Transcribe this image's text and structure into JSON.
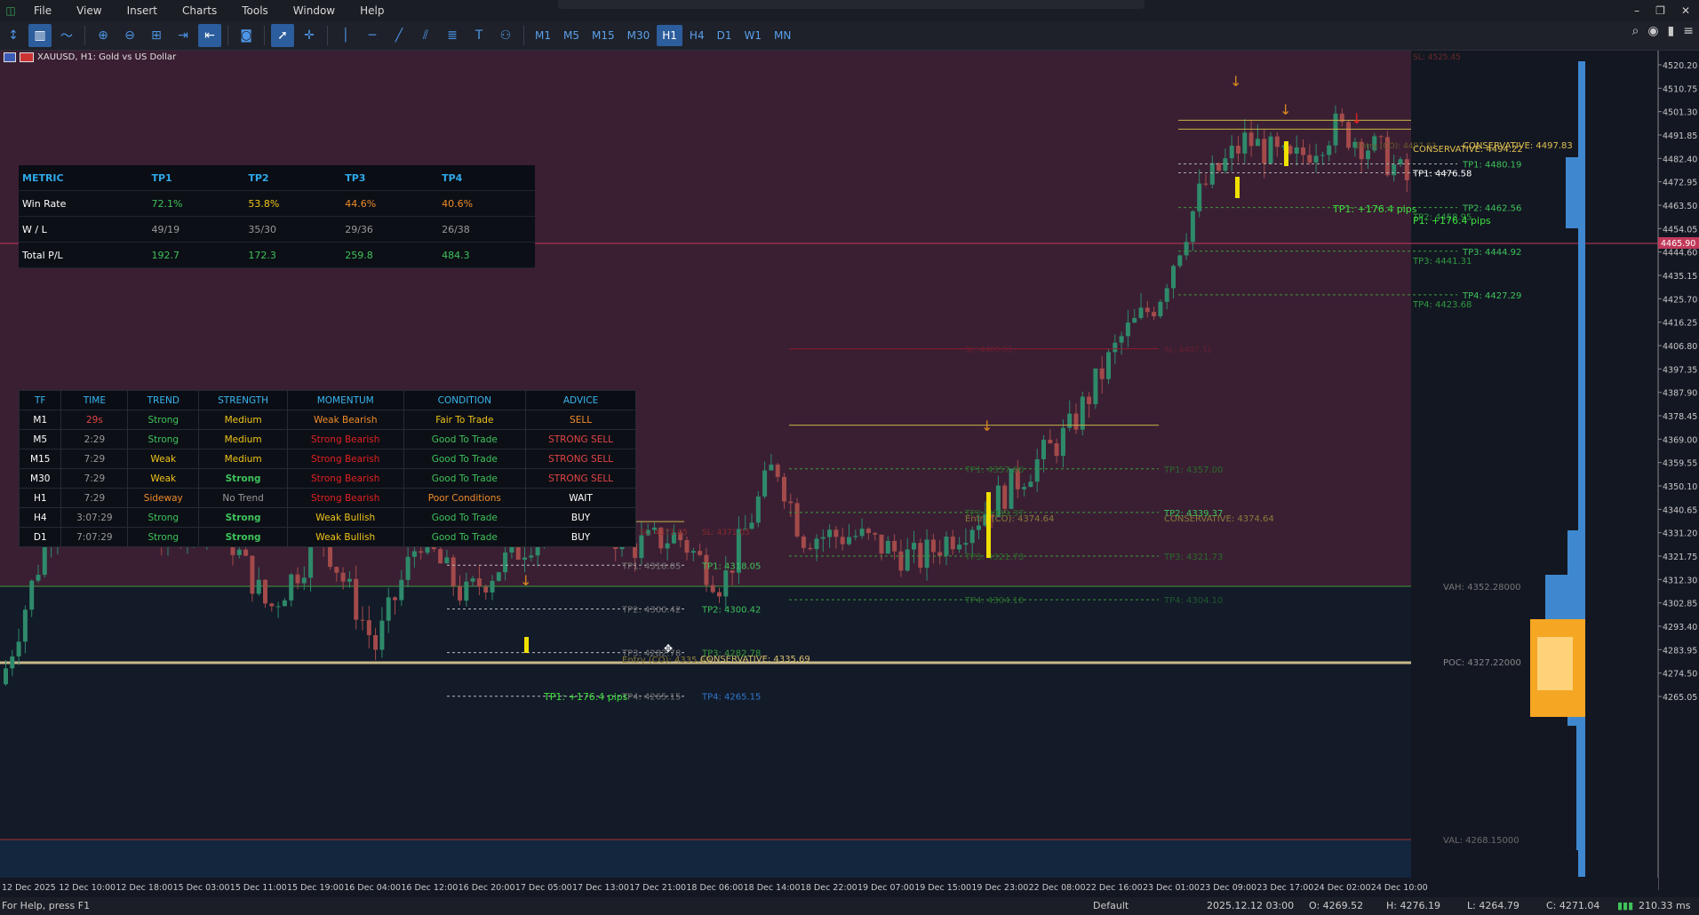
{
  "menu": {
    "items": [
      "File",
      "View",
      "Insert",
      "Charts",
      "Tools",
      "Window",
      "Help"
    ]
  },
  "toolbar": {
    "timeframes": [
      "M1",
      "M5",
      "M15",
      "M30",
      "H1",
      "H4",
      "D1",
      "W1",
      "MN"
    ],
    "active_timeframe": "H1"
  },
  "chart": {
    "symbol_label": "XAUUSD, H1:  Gold vs US Dollar",
    "price_axis": [
      "4520.20",
      "4510.75",
      "4501.30",
      "4491.85",
      "4482.40",
      "4472.95",
      "4463.50",
      "4454.05",
      "4444.60",
      "4435.15",
      "4425.70",
      "4416.25",
      "4406.80",
      "4397.35",
      "4387.90",
      "4378.45",
      "4369.00",
      "4359.55",
      "4350.10",
      "4340.65",
      "4331.20",
      "4321.75",
      "4312.30",
      "4302.85",
      "4293.40",
      "4283.95",
      "4274.50",
      "4265.05"
    ],
    "current_price_tag": "4465.90",
    "top_cut_label": "SL: 4525.45",
    "time_axis": [
      "12 Dec 2025",
      "12 Dec 10:00",
      "12 Dec 18:00",
      "15 Dec 03:00",
      "15 Dec 11:00",
      "15 Dec 19:00",
      "16 Dec 04:00",
      "16 Dec 12:00",
      "16 Dec 20:00",
      "17 Dec 05:00",
      "17 Dec 13:00",
      "17 Dec 21:00",
      "18 Dec 06:00",
      "18 Dec 14:00",
      "18 Dec 22:00",
      "19 Dec 07:00",
      "19 Dec 15:00",
      "19 Dec 23:00",
      "22 Dec 08:00",
      "22 Dec 16:00",
      "23 Dec 01:00",
      "23 Dec 09:00",
      "23 Dec 17:00",
      "24 Dec 02:00",
      "24 Dec 10:00"
    ],
    "volume_profile": {
      "vah": "VAH: 4352.28000",
      "poc": "POC: 4327.22000",
      "val": "VAL: 4268.15000"
    },
    "levels_right": [
      "CONSERVATIVE: 4497.83",
      "CONSERVATIVE: 4494.22",
      "TP1: 4480.19",
      "TP1: 4476.58",
      "TP2: 4462.56",
      "TP2: 4458.95",
      "TP3: 4444.92",
      "TP3: 4441.31",
      "TP4: 4427.29",
      "TP4: 4423.68"
    ],
    "levels_mid": [
      "Entry (CO): 4374.64",
      "CONSERVATIVE: 4374.64",
      "TP1: 4357.00",
      "TP1: 4357.00",
      "TP2: 4339.37",
      "TP2: 4339.37",
      "TP3: 4321.73",
      "TP3: 4321.73",
      "TP4: 4304.10",
      "TP4: 4304.10",
      "SL: 4405.51",
      "SL: 4407.31"
    ],
    "levels_left": [
      "Entry (CO): 4335.69",
      "CONSERVATIVE: 4335.69",
      "TP1: 4318.05",
      "TP1: 4318.05",
      "TP2: 4300.42",
      "TP2: 4300.42",
      "TP3: 4282.78",
      "TP3: 4282.78",
      "TP4: 4265.15",
      "TP4: 4265.15",
      "SL: 4371.05",
      "SL: 4371.05"
    ],
    "pips_labels": [
      "TP1: +176.4 pips",
      "TP1: +176.4 pips",
      "P1: +176.4 pips"
    ],
    "entry_top": "Entry (CO): 4497.83"
  },
  "metric_table": {
    "headers": [
      "METRIC",
      "TP1",
      "TP2",
      "TP3",
      "TP4"
    ],
    "rows": [
      [
        "Win Rate",
        "72.1%",
        "53.8%",
        "44.6%",
        "40.6%"
      ],
      [
        "W / L",
        "49/19",
        "35/30",
        "29/36",
        "26/38"
      ],
      [
        "Total P/L",
        "192.7",
        "172.3",
        "259.8",
        "484.3"
      ]
    ]
  },
  "signal_table": {
    "headers": [
      "TF",
      "TIME",
      "TREND",
      "STRENGTH",
      "MOMENTUM",
      "CONDITION",
      "ADVICE"
    ],
    "rows": [
      [
        "M1",
        "29s",
        "Strong",
        "Medium",
        "Weak Bearish",
        "Fair To Trade",
        "SELL"
      ],
      [
        "M5",
        "2:29",
        "Strong",
        "Medium",
        "Strong Bearish",
        "Good To Trade",
        "STRONG SELL"
      ],
      [
        "M15",
        "7:29",
        "Weak",
        "Medium",
        "Strong Bearish",
        "Good To Trade",
        "STRONG SELL"
      ],
      [
        "M30",
        "7:29",
        "Weak",
        "Strong",
        "Strong Bearish",
        "Good To Trade",
        "STRONG SELL"
      ],
      [
        "H1",
        "7:29",
        "Sideway",
        "No Trend",
        "Strong Bearish",
        "Poor Conditions",
        "WAIT"
      ],
      [
        "H4",
        "3:07:29",
        "Strong",
        "Strong",
        "Weak Bullish",
        "Good To Trade",
        "BUY"
      ],
      [
        "D1",
        "7:07:29",
        "Strong",
        "Strong",
        "Weak Bullish",
        "Good To Trade",
        "BUY"
      ]
    ]
  },
  "status": {
    "help": "For Help, press F1",
    "profile": "Default",
    "datetime": "2025.12.12 03:00",
    "open": "O: 4269.52",
    "high": "H: 4276.19",
    "low": "L: 4264.79",
    "close": "C: 4271.04",
    "ping": "210.33 ms"
  }
}
